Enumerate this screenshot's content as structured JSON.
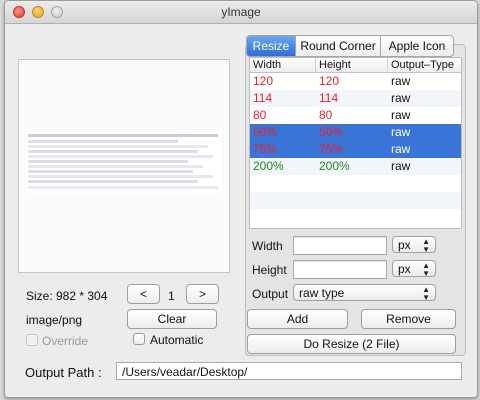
{
  "window": {
    "title": "yImage"
  },
  "left": {
    "size_label": "Size: 982 * 304",
    "page_prev": "<",
    "page_num": "1",
    "page_next": ">",
    "mime": "image/png",
    "clear_label": "Clear",
    "override_label": "Override",
    "automatic_label": "Automatic"
  },
  "tabs": [
    {
      "label": "Resize",
      "active": true
    },
    {
      "label": "Round Corner",
      "active": false
    },
    {
      "label": "Apple Icon",
      "active": false
    }
  ],
  "table": {
    "headers": [
      "Width",
      "Height",
      "Output–Type"
    ],
    "rows": [
      {
        "width": "120",
        "height": "120",
        "type": "raw",
        "color": "#e8202a",
        "selected": false
      },
      {
        "width": "114",
        "height": "114",
        "type": "raw",
        "color": "#e8202a",
        "selected": false
      },
      {
        "width": "80",
        "height": "80",
        "type": "raw",
        "color": "#e8202a",
        "selected": false
      },
      {
        "width": "50%",
        "height": "50%",
        "type": "raw",
        "color": "#e8202a",
        "selected": true
      },
      {
        "width": "75%",
        "height": "75%",
        "type": "raw",
        "color": "#e8202a",
        "selected": true
      },
      {
        "width": "200%",
        "height": "200%",
        "type": "raw",
        "color": "#1e8a1e",
        "selected": false
      }
    ]
  },
  "form": {
    "width_label": "Width",
    "width_value": "",
    "width_unit": "px",
    "height_label": "Height",
    "height_value": "",
    "height_unit": "px",
    "output_label": "Output",
    "output_value": "raw type",
    "add_label": "Add",
    "remove_label": "Remove",
    "do_resize_label": "Do Resize (2 File)"
  },
  "footer": {
    "output_path_label": "Output Path :",
    "output_path_value": "/Users/veadar/Desktop/"
  },
  "colors": {
    "selection": "#3b74d7",
    "tab_active": "#2e6ed8"
  }
}
